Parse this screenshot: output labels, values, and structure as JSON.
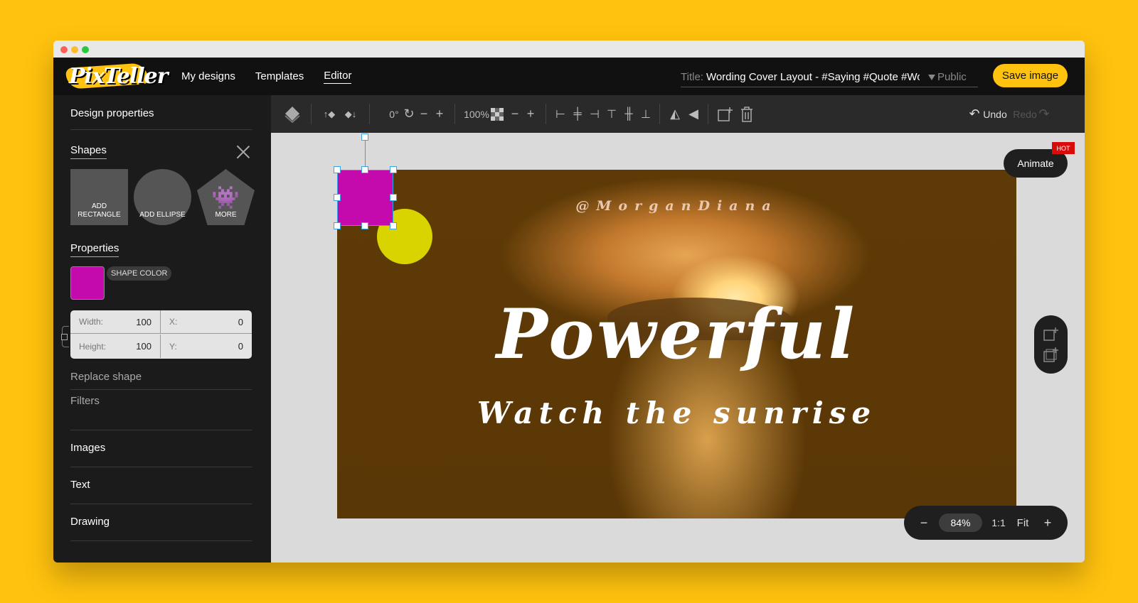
{
  "app": {
    "name": "PixTeller"
  },
  "nav": {
    "my_designs": "My designs",
    "templates": "Templates",
    "editor": "Editor"
  },
  "title": {
    "label": "Title:",
    "value": "Wording Cover Layout - #Saying #Quote #Wording",
    "visibility": "Public"
  },
  "save_label": "Save image",
  "sidebar": {
    "design_properties": "Design properties",
    "shapes_title": "Shapes",
    "add_rectangle": "ADD RECTANGLE",
    "add_ellipse": "ADD ELLIPSE",
    "more": "MORE",
    "properties_title": "Properties",
    "shape_color_label": "SHAPE COLOR",
    "shape_color": "#c40aac",
    "width_label": "Width:",
    "width": "100",
    "height_label": "Height:",
    "height": "100",
    "x_label": "X:",
    "x": "0",
    "y_label": "Y:",
    "y": "0",
    "replace_shape": "Replace shape",
    "filters": "Filters",
    "images": "Images",
    "text": "Text",
    "drawing": "Drawing"
  },
  "toolbar": {
    "rotation": "0°",
    "opacity": "100%",
    "undo": "Undo",
    "redo": "Redo"
  },
  "canvas": {
    "handle": "@MorganDiana",
    "headline": "Powerful",
    "subline": "Watch the sunrise",
    "accent_color": "#ffc20e",
    "circle_color": "#d9d400"
  },
  "animate": {
    "label": "Animate",
    "badge": "HOT"
  },
  "zoom": {
    "value": "84%",
    "one_to_one": "1:1",
    "fit": "Fit"
  }
}
